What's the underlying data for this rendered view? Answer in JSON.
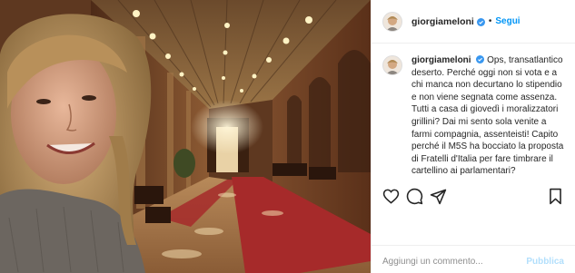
{
  "post": {
    "username": "giorgiameloni",
    "follow_label": "Segui",
    "separator": "•",
    "caption": {
      "username": "giorgiameloni",
      "text": "Ops, transatlantico deserto. Perché oggi non si vota e a chi manca non decurtano lo stipendio e non viene segnata come assenza. Tutti a casa di giovedì i moralizzatori grillini? Dai mi sento sola venite a farmi compagnia, assenteisti! Capito perché il M5S ha bocciato la proposta di Fratelli d'Italia per fare timbrare il cartellino ai parlamentari?"
    },
    "comment": {
      "placeholder": "Aggiungi un commento...",
      "publish_label": "Pubblica"
    },
    "colors": {
      "accent": "#0095f6",
      "verified": "#3897f0",
      "publish_disabled": "#b2dffc"
    },
    "icons": [
      "verified-badge-icon",
      "heart-icon",
      "comment-icon",
      "share-icon",
      "bookmark-icon"
    ]
  }
}
